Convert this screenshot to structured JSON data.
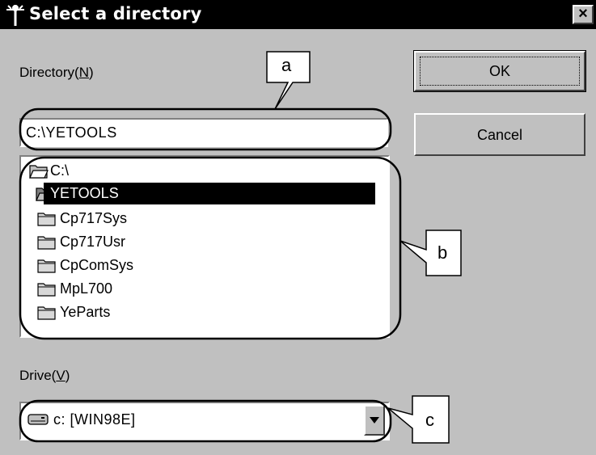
{
  "window": {
    "title": "Select a directory",
    "close_glyph": "×"
  },
  "directory": {
    "label": "Directory",
    "mnemonic": "N",
    "value": "C:\\YETOOLS"
  },
  "tree": {
    "items": [
      {
        "label": "C:\\",
        "icon": "open-folder-icon",
        "level": 0,
        "selected": false
      },
      {
        "label": "YETOOLS",
        "icon": "open-folder-icon",
        "level": 1,
        "selected": true
      },
      {
        "label": "Cp717Sys",
        "icon": "folder-icon",
        "level": 1,
        "selected": false
      },
      {
        "label": "Cp717Usr",
        "icon": "folder-icon",
        "level": 1,
        "selected": false
      },
      {
        "label": "CpComSys",
        "icon": "folder-icon",
        "level": 1,
        "selected": false
      },
      {
        "label": "MpL700",
        "icon": "folder-icon",
        "level": 1,
        "selected": false
      },
      {
        "label": "YeParts",
        "icon": "folder-icon",
        "level": 1,
        "selected": false
      }
    ]
  },
  "drive": {
    "label": "Drive",
    "mnemonic": "V",
    "value": "c: [WIN98E]",
    "icon": "hard-drive-icon"
  },
  "buttons": {
    "ok_label": "OK",
    "cancel_label": "Cancel"
  },
  "callouts": {
    "a": "a",
    "b": "b",
    "c": "c"
  },
  "colors": {
    "titlebar": "#000000",
    "dialog_bg": "#c0c0c0",
    "selection": "#000000"
  }
}
